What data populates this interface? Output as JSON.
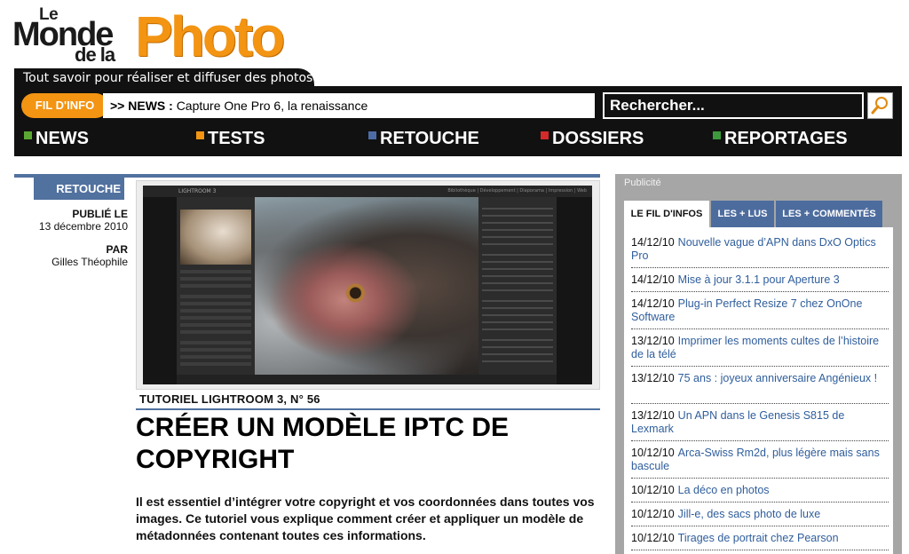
{
  "logo": {
    "le": "Le",
    "monde": "Monde",
    "dela": "de la",
    "photo": "Photo"
  },
  "tagline": "Tout savoir pour réaliser et diffuser des photos",
  "ticker": {
    "badge": "FIL D'INFO",
    "prefix": ">> NEWS :",
    "headline": "Capture One Pro 6, la renaissance"
  },
  "search": {
    "placeholder": "Rechercher..."
  },
  "nav": [
    {
      "label": "NEWS",
      "color": "#5aa832"
    },
    {
      "label": "TESTS",
      "color": "#f39412"
    },
    {
      "label": "RETOUCHE",
      "color": "#4d6ca6"
    },
    {
      "label": "DOSSIERS",
      "color": "#d32a2a"
    },
    {
      "label": "REPORTAGES",
      "color": "#3c9a3c"
    }
  ],
  "article": {
    "section": "RETOUCHE",
    "published_label": "PUBLIÉ LE",
    "published_date": "13 décembre 2010",
    "by_label": "PAR",
    "author": "Gilles Théophile",
    "image": {
      "app_title": "LIGHTROOM 3",
      "modules": "Bibliothèque | Développement | Diaporama | Impression | Web"
    },
    "kicker": "TUTORIEL LIGHTROOM 3, N° 56",
    "headline": "CRÉER UN MODÈLE IPTC DE COPYRIGHT",
    "intro": "Il est essentiel d’intégrer votre copyright et vos coordonnées dans toutes vos images. Ce tutoriel vous explique comment créer et appliquer un modèle de métadonnées contenant toutes ces informations."
  },
  "sidebar": {
    "pub_label": "Publicité",
    "tabs": [
      "LE FIL D'INFOS",
      "LES + LUS",
      "LES + COMMENTÉS"
    ],
    "news": [
      {
        "date": "14/12/10",
        "title": "Nouvelle vague d’APN dans DxO Optics Pro"
      },
      {
        "date": "14/12/10",
        "title": "Mise à jour 3.1.1 pour Aperture 3"
      },
      {
        "date": "14/12/10",
        "title": "Plug-in Perfect Resize 7 chez OnOne Software"
      },
      {
        "date": "13/12/10",
        "title": "Imprimer les moments cultes de l’histoire de la télé"
      },
      {
        "date": "13/12/10",
        "title": "75 ans : joyeux anniversaire Angénieux !"
      },
      {
        "date": "13/12/10",
        "title": "Un APN dans le Genesis S815 de Lexmark"
      },
      {
        "date": "10/12/10",
        "title": "Arca-Swiss Rm2d, plus légère mais sans bascule"
      },
      {
        "date": "10/12/10",
        "title": "La déco en photos"
      },
      {
        "date": "10/12/10",
        "title": "Jill-e, des sacs photo de luxe"
      },
      {
        "date": "10/12/10",
        "title": "Tirages de portrait chez Pearson"
      }
    ]
  }
}
